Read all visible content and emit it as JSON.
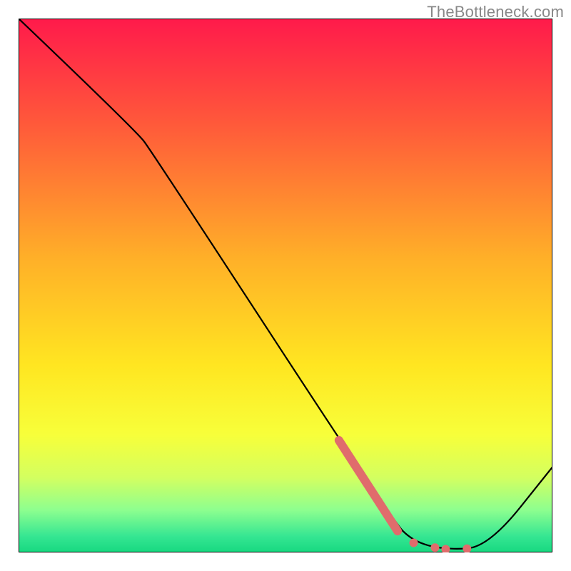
{
  "attribution": "TheBottleneck.com",
  "chart_data": {
    "type": "line",
    "title": "",
    "xlabel": "",
    "ylabel": "",
    "xlim": [
      0,
      100
    ],
    "ylim": [
      0,
      100
    ],
    "background_gradient": {
      "stops": [
        {
          "offset": 0,
          "color": "#ff1a4b"
        },
        {
          "offset": 20,
          "color": "#ff5a3a"
        },
        {
          "offset": 45,
          "color": "#ffb028"
        },
        {
          "offset": 65,
          "color": "#ffe621"
        },
        {
          "offset": 78,
          "color": "#f7ff3a"
        },
        {
          "offset": 86,
          "color": "#d3ff60"
        },
        {
          "offset": 92,
          "color": "#8eff8f"
        },
        {
          "offset": 97,
          "color": "#35e692"
        },
        {
          "offset": 100,
          "color": "#17d880"
        }
      ]
    },
    "series": [
      {
        "name": "bottleneck-curve",
        "color": "#000000",
        "points": [
          {
            "x": 0,
            "y": 100
          },
          {
            "x": 22,
            "y": 79
          },
          {
            "x": 25,
            "y": 75
          },
          {
            "x": 70,
            "y": 6
          },
          {
            "x": 74,
            "y": 2
          },
          {
            "x": 80,
            "y": 0.5
          },
          {
            "x": 88,
            "y": 1
          },
          {
            "x": 100,
            "y": 16
          }
        ]
      }
    ],
    "highlight_segment": {
      "name": "highlight-band",
      "color": "#e06c6c",
      "width": 12,
      "points": [
        {
          "x": 60,
          "y": 21
        },
        {
          "x": 71,
          "y": 4
        }
      ]
    },
    "highlight_dots": {
      "name": "highlight-dots",
      "color": "#e06c6c",
      "radius": 6,
      "points": [
        {
          "x": 74,
          "y": 1.8
        },
        {
          "x": 78,
          "y": 0.9
        },
        {
          "x": 80,
          "y": 0.6
        },
        {
          "x": 84,
          "y": 0.7
        }
      ]
    }
  }
}
